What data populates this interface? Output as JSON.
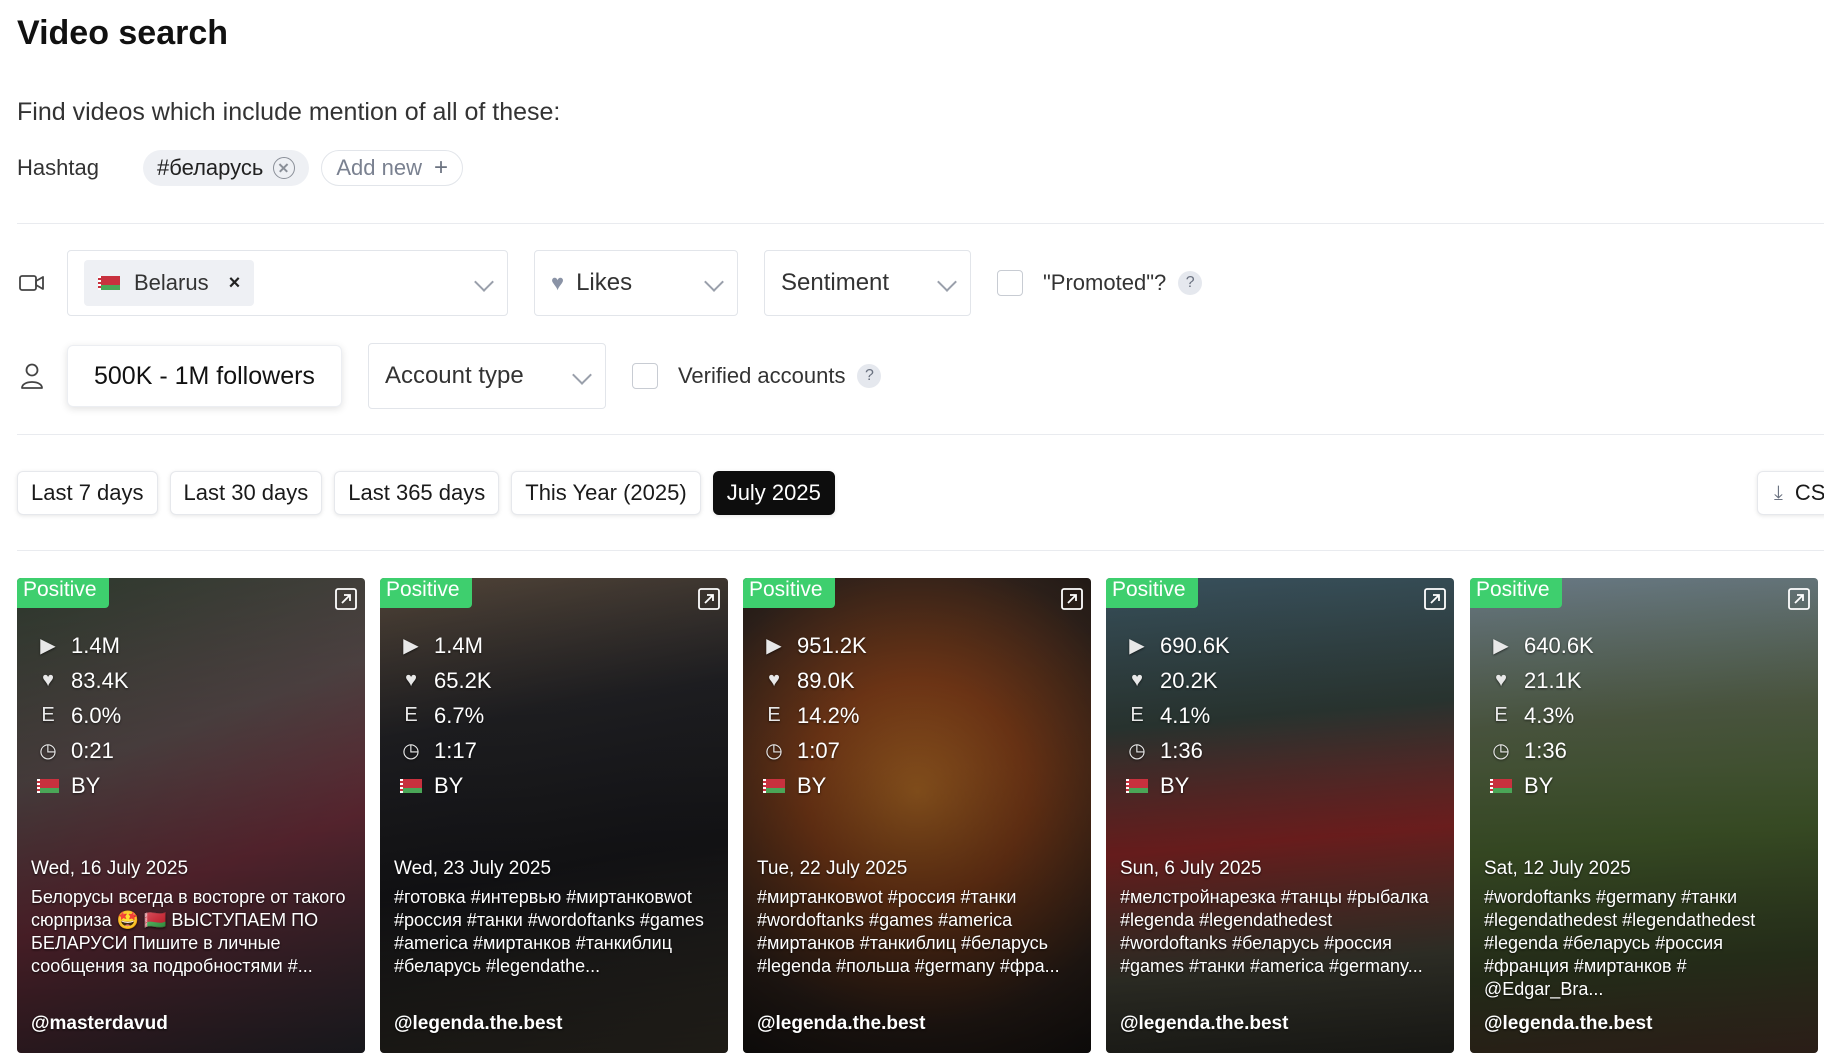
{
  "page": {
    "title": "Video search",
    "subtitle": "Find videos which include mention of all of these:"
  },
  "hashtags": {
    "label": "Hashtag",
    "items": [
      "#беларусь"
    ],
    "add_label": "Add new"
  },
  "filters": {
    "country": "Belarus",
    "likes": "Likes",
    "sentiment": "Sentiment",
    "promoted_label": "\"Promoted\"?",
    "help_mark": "?",
    "followers": "500K - 1M followers",
    "account_type": "Account type",
    "verified_label": "Verified accounts"
  },
  "periods": [
    "Last 7 days",
    "Last 30 days",
    "Last 365 days",
    "This Year (2025)",
    "July 2025"
  ],
  "active_period": "July 2025",
  "export_label": "CSV",
  "colors": {
    "positive_badge": "#3ecf6e",
    "active_period_bg": "#0d0d0d"
  },
  "cards": [
    {
      "sentiment": "Positive",
      "views": "1.4M",
      "likes": "83.4K",
      "engagement": "6.0%",
      "duration": "0:21",
      "country": "BY",
      "date": "Wed, 16 July 2025",
      "description": "Белорусы всегда в восторге от такого сюрприза 🤩 🇧🇾 ВЫСТУПАЕМ ПО БЕЛАРУСИ Пишите в личные сообщения за подробностями #...",
      "user": "@masterdavud",
      "bg": "linear-gradient(160deg,#3a4a3a 0%,#6a5a5a 35%,#8a3a4a 60%,#3a3a44 100%)"
    },
    {
      "sentiment": "Positive",
      "views": "1.4M",
      "likes": "65.2K",
      "engagement": "6.7%",
      "duration": "1:17",
      "country": "BY",
      "date": "Wed, 23 July 2025",
      "description": "#готовка #интервью #миртанковwot #россия #танки #wordoftanks #games #america #миртанков #танкиблиц #беларусь #legendathe...",
      "user": "@legenda.the.best",
      "bg": "linear-gradient(170deg,#6b5a4a 0%,#2a2a2e 30%,#1e1e22 60%,#4a4438 100%)"
    },
    {
      "sentiment": "Positive",
      "views": "951.2K",
      "likes": "89.0K",
      "engagement": "14.2%",
      "duration": "1:07",
      "country": "BY",
      "date": "Tue, 22 July 2025",
      "description": "#миртанковwot #россия #танки #wordoftanks #games #america #миртанков #танкиблиц #беларусь #legenda #польша #germany #фра...",
      "user": "@legenda.the.best",
      "bg": "radial-gradient(circle at 50% 45%,#c8782a 0%,#9a4a1e 35%,#3a2a22 75%,#1e1a18 100%)"
    },
    {
      "sentiment": "Positive",
      "views": "690.6K",
      "likes": "20.2K",
      "engagement": "4.1%",
      "duration": "1:36",
      "country": "BY",
      "date": "Sun, 6 July 2025",
      "description": "#мелстройнарезка #танцы #рыбалка #legenda #legendathedest #wordoftanks #беларусь #россия #games #танки #america #germany...",
      "user": "@legenda.the.best",
      "bg": "linear-gradient(175deg,#4a6a7a 0%,#3a4a44 30%,#b03030 55%,#5a5a4a 80%,#3a3a32 100%)"
    },
    {
      "sentiment": "Positive",
      "views": "640.6K",
      "likes": "21.1K",
      "engagement": "4.3%",
      "duration": "1:36",
      "country": "BY",
      "date": "Sat, 12 July 2025",
      "description": "#wordoftanks #germany #танки #legendathedest #legendathedest #legenda #беларусь #россия #франция #миртанков # @Edgar_Bra...",
      "user": "@legenda.the.best",
      "bg": "linear-gradient(175deg,#8aa0b0 0%,#6a7a5a 30%,#5a7a3a 55%,#4a5a32 80%,#6a4a3a 100%)"
    }
  ]
}
